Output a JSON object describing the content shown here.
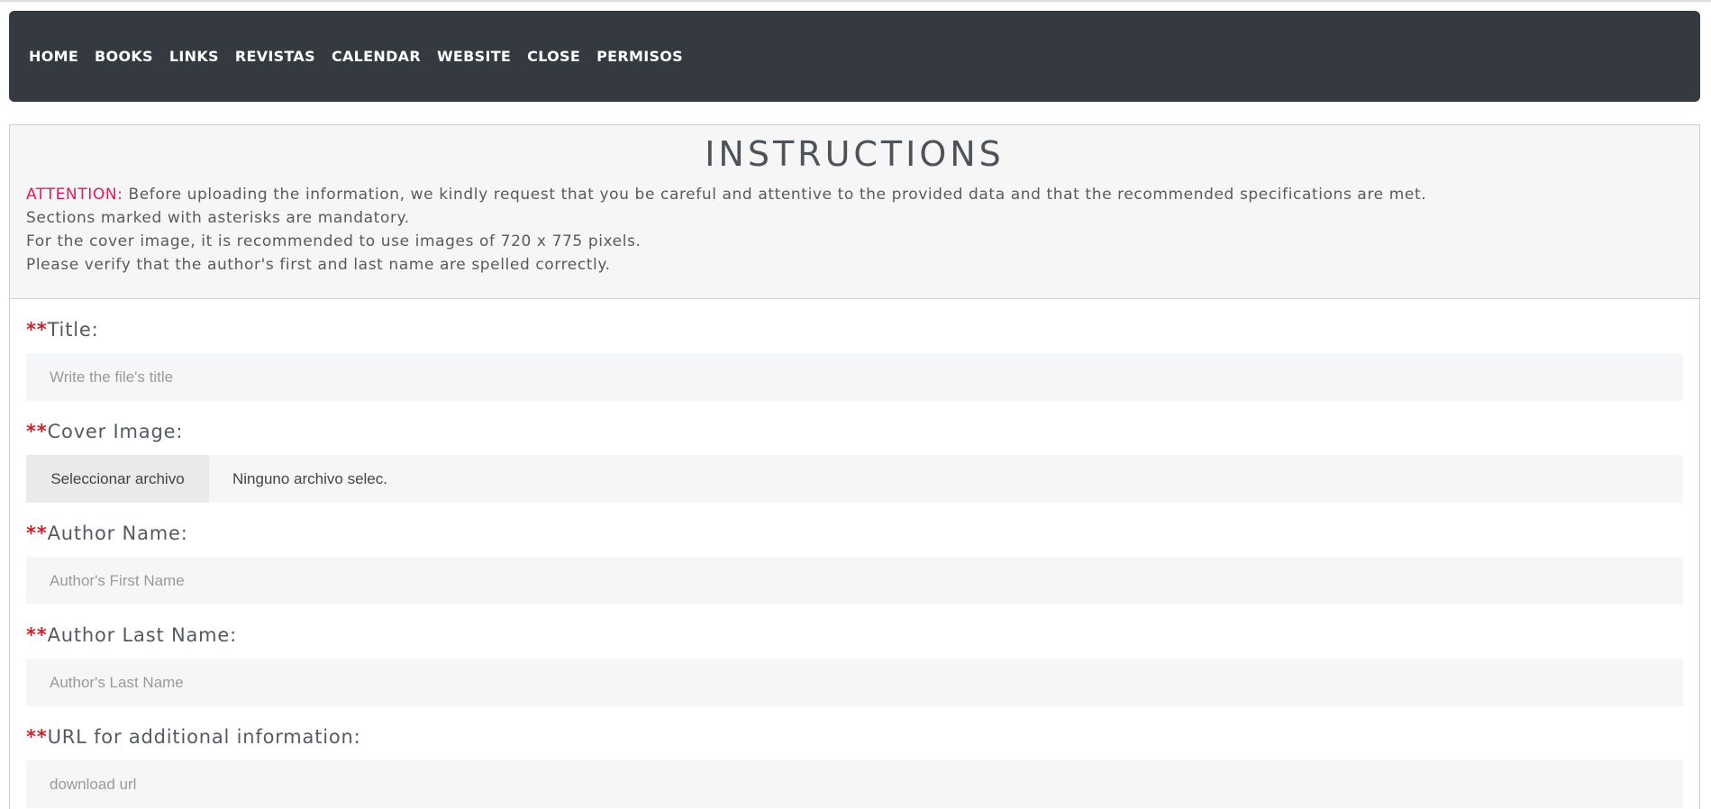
{
  "nav": {
    "items": [
      {
        "label": "HOME"
      },
      {
        "label": "BOOKS"
      },
      {
        "label": "LINKS"
      },
      {
        "label": "REVISTAS"
      },
      {
        "label": "CALENDAR"
      },
      {
        "label": "WEBSITE"
      },
      {
        "label": "CLOSE"
      },
      {
        "label": "PERMISOS"
      }
    ],
    "background": "#343a40"
  },
  "instructions": {
    "title": "INSTRUCTIONS",
    "attention_label": "ATTENTION:",
    "attention_text": " Before uploading the information, we kindly request that you be careful and attentive to the provided data and that the recommended specifications are met.",
    "lines": [
      "Sections marked with asterisks are mandatory.",
      "For the cover image, it is recommended to use images of 720 x 775 pixels.",
      "Please verify that the author's first and last name are spelled correctly."
    ],
    "attention_color": "#e8175d"
  },
  "form": {
    "required_marker": "**",
    "title": {
      "label": "Title:",
      "placeholder": "Write the file's title"
    },
    "cover": {
      "label": "Cover Image:",
      "button": "Seleccionar archivo",
      "status": "Ninguno archivo selec."
    },
    "author_first": {
      "label": "Author Name:",
      "placeholder": "Author's First Name"
    },
    "author_last": {
      "label": "Author Last Name:",
      "placeholder": "Author's Last Name"
    },
    "url": {
      "label": "URL for additional information:",
      "placeholder": "download url"
    }
  }
}
